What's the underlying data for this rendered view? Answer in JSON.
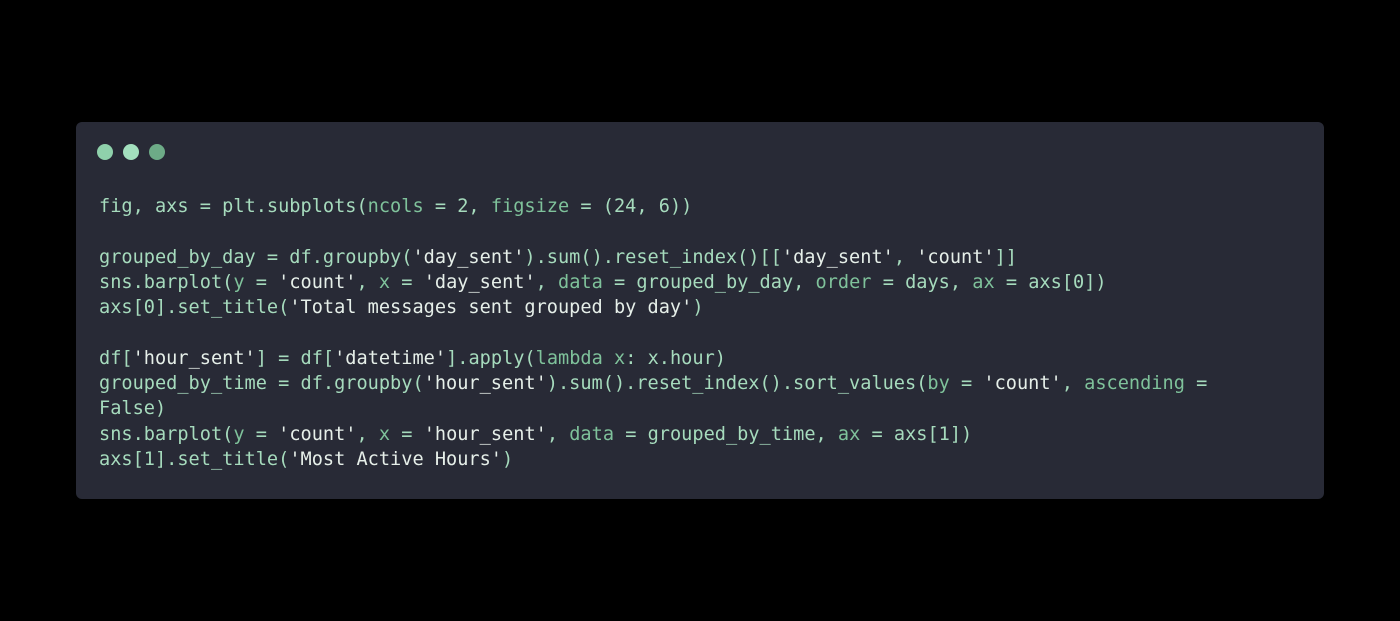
{
  "window": {
    "traffic_lights": [
      {
        "name": "close",
        "color": "#8fd1ab"
      },
      {
        "name": "minimize",
        "color": "#a3e0be"
      },
      {
        "name": "maximize",
        "color": "#6dab87"
      }
    ]
  },
  "colors": {
    "default": "#a6dbbd",
    "string": "#e6efe9",
    "param": "#7fc29b",
    "window_bg": "#282a36",
    "page_bg": "#000000"
  },
  "code": {
    "language": "python",
    "lines": [
      [
        {
          "t": "fig, axs = plt.subplots(",
          "c": "default"
        },
        {
          "t": "ncols",
          "c": "param"
        },
        {
          "t": " = 2, ",
          "c": "default"
        },
        {
          "t": "figsize",
          "c": "param"
        },
        {
          "t": " = (24, 6))",
          "c": "default"
        }
      ],
      [],
      [
        {
          "t": "grouped_by_day = df.groupby(",
          "c": "default"
        },
        {
          "t": "'day_sent'",
          "c": "string"
        },
        {
          "t": ").sum().reset_index()[[",
          "c": "default"
        },
        {
          "t": "'day_sent'",
          "c": "string"
        },
        {
          "t": ", ",
          "c": "default"
        },
        {
          "t": "'count'",
          "c": "string"
        },
        {
          "t": "]]",
          "c": "default"
        }
      ],
      [
        {
          "t": "sns.barplot(",
          "c": "default"
        },
        {
          "t": "y",
          "c": "param"
        },
        {
          "t": " = ",
          "c": "default"
        },
        {
          "t": "'count'",
          "c": "string"
        },
        {
          "t": ", ",
          "c": "default"
        },
        {
          "t": "x",
          "c": "param"
        },
        {
          "t": " = ",
          "c": "default"
        },
        {
          "t": "'day_sent'",
          "c": "string"
        },
        {
          "t": ", ",
          "c": "default"
        },
        {
          "t": "data",
          "c": "param"
        },
        {
          "t": " = grouped_by_day, ",
          "c": "default"
        },
        {
          "t": "order",
          "c": "param"
        },
        {
          "t": " = days, ",
          "c": "default"
        },
        {
          "t": "ax",
          "c": "param"
        },
        {
          "t": " = axs[0])",
          "c": "default"
        }
      ],
      [
        {
          "t": "axs[0].set_title(",
          "c": "default"
        },
        {
          "t": "'Total messages sent grouped by day'",
          "c": "string"
        },
        {
          "t": ")",
          "c": "default"
        }
      ],
      [],
      [
        {
          "t": "df[",
          "c": "default"
        },
        {
          "t": "'hour_sent'",
          "c": "string"
        },
        {
          "t": "] = df[",
          "c": "default"
        },
        {
          "t": "'datetime'",
          "c": "string"
        },
        {
          "t": "].apply(",
          "c": "default"
        },
        {
          "t": "lambda",
          "c": "param"
        },
        {
          "t": " ",
          "c": "default"
        },
        {
          "t": "x",
          "c": "param"
        },
        {
          "t": ": x.hour)",
          "c": "default"
        }
      ],
      [
        {
          "t": "grouped_by_time = df.groupby(",
          "c": "default"
        },
        {
          "t": "'hour_sent'",
          "c": "string"
        },
        {
          "t": ").sum().reset_index().sort_values(",
          "c": "default"
        },
        {
          "t": "by",
          "c": "param"
        },
        {
          "t": " = ",
          "c": "default"
        },
        {
          "t": "'count'",
          "c": "string"
        },
        {
          "t": ", ",
          "c": "default"
        },
        {
          "t": "ascending",
          "c": "param"
        },
        {
          "t": " =",
          "c": "default"
        }
      ],
      [
        {
          "t": "False)",
          "c": "default"
        }
      ],
      [
        {
          "t": "sns.barplot(",
          "c": "default"
        },
        {
          "t": "y",
          "c": "param"
        },
        {
          "t": " = ",
          "c": "default"
        },
        {
          "t": "'count'",
          "c": "string"
        },
        {
          "t": ", ",
          "c": "default"
        },
        {
          "t": "x",
          "c": "param"
        },
        {
          "t": " = ",
          "c": "default"
        },
        {
          "t": "'hour_sent'",
          "c": "string"
        },
        {
          "t": ", ",
          "c": "default"
        },
        {
          "t": "data",
          "c": "param"
        },
        {
          "t": " = grouped_by_time, ",
          "c": "default"
        },
        {
          "t": "ax",
          "c": "param"
        },
        {
          "t": " = axs[1])",
          "c": "default"
        }
      ],
      [
        {
          "t": "axs[1].set_title(",
          "c": "default"
        },
        {
          "t": "'Most Active Hours'",
          "c": "string"
        },
        {
          "t": ")",
          "c": "default"
        }
      ]
    ]
  }
}
